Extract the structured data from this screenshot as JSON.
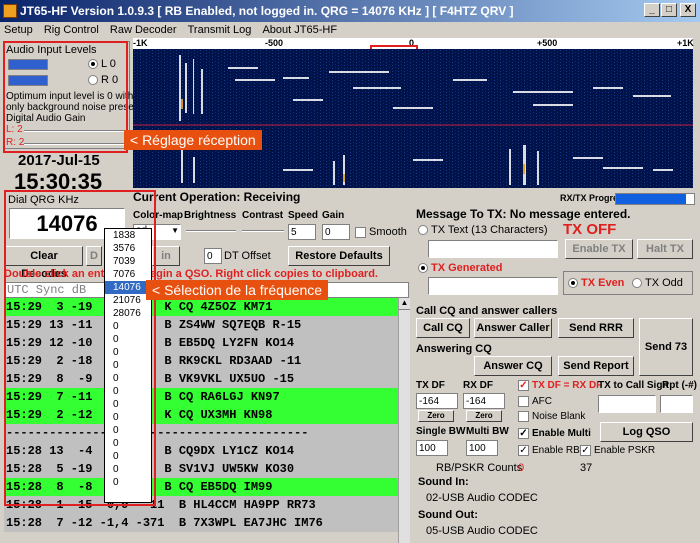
{
  "window": {
    "title": "JT65-HF Version 1.0.9.3  [ RB Enabled, not logged in.  QRG = 14076 KHz ]  [ F4HTZ QRV ]",
    "minimize": "_",
    "maximize": "□",
    "close": "X"
  },
  "menu": [
    "Setup",
    "Rig Control",
    "Raw Decoder",
    "Transmit Log",
    "About JT65-HF"
  ],
  "audio": {
    "title": "Audio Input Levels",
    "left_label": "L 0",
    "right_label": "R 0",
    "left_level": 0.55,
    "right_level": 0.55,
    "status_line1": "Optimum input level is 0 with",
    "status_line2": "only background noise present.",
    "gain_label": "Digital Audio Gain",
    "gain_l": "L: 2",
    "gain_r": "R: 2"
  },
  "date": "2017-Jul-15",
  "time": "15:30:35",
  "callouts": {
    "reception": "< Réglage réception",
    "frequency": "< Sélection de la fréquence"
  },
  "scale": {
    "labels": [
      "-1K",
      "-500",
      "0",
      "+500",
      "+1K"
    ]
  },
  "operation": {
    "label": "Current Operation:  Receiving",
    "tx_progress": "RX/TX Progress",
    "tx_progress_value": 1.0
  },
  "dial": {
    "label": "Dial QRG KHz",
    "value": "14076",
    "options": [
      "1838",
      "3576",
      "7039",
      "7076",
      "14076",
      "21076",
      "28076",
      "0",
      "0",
      "0",
      "0",
      "0",
      "0",
      "0",
      "0",
      "0",
      "0",
      "0",
      "0",
      "0"
    ],
    "selected_index": 4
  },
  "controls": {
    "colormap_label": "Color-map",
    "colormap_value": "ad",
    "brightness_label": "Brightness",
    "contrast_label": "Contrast",
    "speed_label": "Speed",
    "speed_value": "5",
    "gain_label": "Gain",
    "gain_value": "0",
    "smooth_label": "Smooth",
    "dt_value": "0",
    "dt_label": "DT Offset",
    "restore_defaults": "Restore Defaults",
    "clear_decodes": "Clear Decodes",
    "hidden_btn": "D",
    "hidden_btn2": "in"
  },
  "hint": {
    "left": "Double click an entry",
    "right": "egin a QSO.  Right click copies to clipboard."
  },
  "decodes": {
    "header": " UTC  Sync  dB",
    "rows": [
      {
        "text": "15:29  3 -19",
        "rest": "     931  K CQ 4Z5OZ KM71",
        "style": "g"
      },
      {
        "text": "15:29 13 -11",
        "rest": "     514  B ZS4WW SQ7EQB R-15",
        "style": "w"
      },
      {
        "text": "15:29 12 -10",
        "rest": "     366  B EB5DQ LY2FN KO14",
        "style": "w"
      },
      {
        "text": "15:29  2 -18",
        "rest": "    -522  B RK9CKL RD3AAD -11",
        "style": "w"
      },
      {
        "text": "15:29  8  -9",
        "rest": "    -646  B VK9VKL UX5UO -15",
        "style": "w"
      },
      {
        "text": "15:29  7 -11",
        "rest": "    -799  B CQ RA6LGJ KN97",
        "style": "g"
      },
      {
        "text": "15:29  2 -12",
        "rest": "    -877  K CQ UX3MH KN98",
        "style": "g"
      },
      {
        "text": "------------",
        "rest": "------------------------------",
        "style": "w"
      },
      {
        "text": "15:28 13  -4",
        "rest": "     877  B CQ9DX LY1CZ KO14",
        "style": "w"
      },
      {
        "text": "15:28  5 -19",
        "rest": "     689  B SV1VJ UW5KW KO30",
        "style": "w"
      },
      {
        "text": "15:28  8  -8",
        "rest": "     363  B CQ EB5DQ IM99",
        "style": "g"
      },
      {
        "text": "15:28  1 -15",
        "rest": " -0,9  -11  B HL4CCM HA9PP RR73",
        "style": "w"
      },
      {
        "text": "15:28  7 -12",
        "rest": " -1,4 -371  B 7X3WPL EA7JHC IM76",
        "style": "w"
      }
    ]
  },
  "tx": {
    "title": "Message To TX:  No message entered.",
    "tx_off": "TX OFF",
    "tx_text_label": "TX Text (13 Characters)",
    "enable_tx": "Enable TX",
    "halt_tx": "Halt TX",
    "tx_generated": "TX Generated",
    "tx_even": "TX Even",
    "tx_odd": "TX Odd",
    "cq_section": "Call CQ and answer callers",
    "call_cq": "Call CQ",
    "answer_caller": "Answer Caller",
    "send_rrr": "Send RRR",
    "answering_cq": "Answering CQ",
    "answer_cq": "Answer CQ",
    "send_report": "Send Report",
    "send_73": "Send 73",
    "tx_df_label": "TX DF",
    "tx_df_value": "-164",
    "rx_df_label": "RX DF",
    "rx_df_value": "-164",
    "zero": "Zero",
    "tx_eq_rx": "TX DF = RX DF",
    "afc": "AFC",
    "noise_blank": "Noise Blank",
    "enable_multi": "Enable Multi",
    "enable_rb": "Enable RB",
    "enable_pskr": "Enable PSKR",
    "tx_to_call": "TX to Call Sign",
    "rpt": "Rpt (-#)",
    "log_qso": "Log QSO",
    "single_bw": "Single BW",
    "single_bw_value": "100",
    "multi_bw": "Multi BW",
    "multi_bw_value": "100",
    "counts_label": "RB/PSKR Counts",
    "rb_count": "0",
    "pskr_count": "37",
    "sound_in_label": "Sound In:",
    "sound_in": "02-USB Audio CODEC",
    "sound_out_label": "Sound Out:",
    "sound_out": "05-USB Audio CODEC"
  },
  "colors": {
    "title_start": "#0a246a",
    "title_end": "#a6caf0",
    "decode_green": "#33ff33",
    "decode_gray": "#c0c0c0",
    "callout": "#e85010",
    "alert_red": "#e02020"
  }
}
